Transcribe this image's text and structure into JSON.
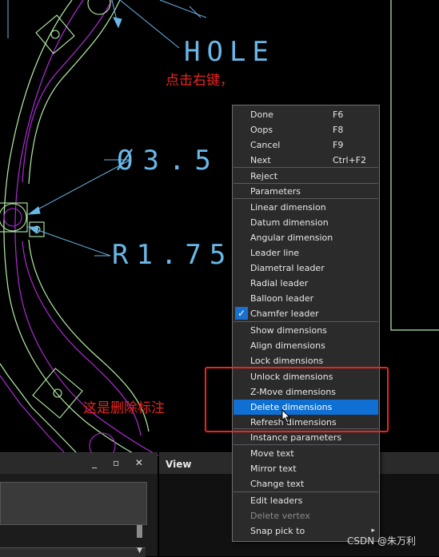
{
  "drawing": {
    "hole_label": "HOLE",
    "diameter_label": "Ø3.5",
    "radius_label": "R1.75"
  },
  "annotations": {
    "right_click_note": "点击右键，",
    "delete_note": "这是删除标注"
  },
  "bottom_panel": {
    "controls": "_ ▫ ✕",
    "combo_arrow": "▼"
  },
  "view_panel": {
    "title": "View",
    "controls": "_ ▫ ✕"
  },
  "context_menu": {
    "items": [
      {
        "label": "Done",
        "shortcut": "F6"
      },
      {
        "label": "Oops",
        "shortcut": "F8"
      },
      {
        "label": "Cancel",
        "shortcut": "F9"
      },
      {
        "label": "Next",
        "shortcut": "Ctrl+F2"
      },
      {
        "label": "Reject"
      },
      {
        "label": "Parameters"
      },
      {
        "label": "Linear dimension"
      },
      {
        "label": "Datum dimension"
      },
      {
        "label": "Angular dimension"
      },
      {
        "label": "Leader line"
      },
      {
        "label": "Diametral leader"
      },
      {
        "label": "Radial leader"
      },
      {
        "label": "Balloon leader"
      },
      {
        "label": "Chamfer leader",
        "checked": true
      },
      {
        "label": "Show dimensions"
      },
      {
        "label": "Align dimensions"
      },
      {
        "label": "Lock dimensions"
      },
      {
        "label": "Unlock dimensions"
      },
      {
        "label": "Z-Move dimensions"
      },
      {
        "label": "Delete dimensions",
        "selected": true
      },
      {
        "label": "Refresh dimensions"
      },
      {
        "label": "Instance parameters"
      },
      {
        "label": "Move text"
      },
      {
        "label": "Mirror text"
      },
      {
        "label": "Change text"
      },
      {
        "label": "Edit leaders"
      },
      {
        "label": "Delete vertex",
        "disabled": true
      },
      {
        "label": "Snap pick to",
        "submenu": true
      }
    ],
    "check_icon": "✓",
    "submenu_arrow": "▸"
  },
  "watermark": "CSDN @朱万利",
  "colors": {
    "outline_green": "#b6f0a8",
    "outline_magenta": "#b02bd8",
    "dimension_blue": "#6ab8e8",
    "annotation_red": "#e8261f",
    "menu_highlight": "#0f6fd2"
  }
}
